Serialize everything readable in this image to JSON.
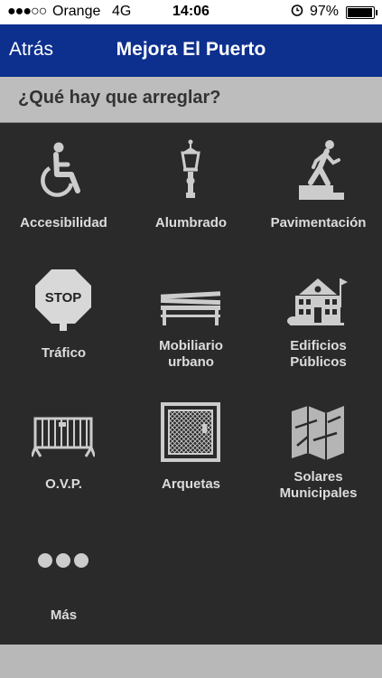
{
  "status_bar": {
    "signal_dots": "●●●○○",
    "carrier": "Orange",
    "network": "4G",
    "time": "14:06",
    "alarm_icon": "alarm-icon",
    "battery_percent": "97%",
    "battery_level": 0.97
  },
  "nav": {
    "back_label": "Atrás",
    "title": "Mejora El Puerto",
    "bar_color": "#0d2f8e"
  },
  "section": {
    "heading": "¿Qué hay que arreglar?"
  },
  "categories": [
    {
      "label": "Accesibilidad",
      "icon": "wheelchair-icon"
    },
    {
      "label": "Alumbrado",
      "icon": "street-lamp-icon"
    },
    {
      "label": "Pavimentación",
      "icon": "pedestrian-step-icon"
    },
    {
      "label": "Tráfico",
      "icon": "stop-sign-icon",
      "sign_text": "STOP"
    },
    {
      "label": "Mobiliario urbano",
      "line1": "Mobiliario",
      "line2": "urbano",
      "icon": "bench-icon"
    },
    {
      "label": "Edificios Públicos",
      "line1": "Edificios",
      "line2": "Públicos",
      "icon": "public-building-icon"
    },
    {
      "label": "O.V.P.",
      "icon": "barrier-fence-icon"
    },
    {
      "label": "Arquetas",
      "icon": "manhole-cover-icon"
    },
    {
      "label": "Solares Municipales",
      "line1": "Solares",
      "line2": "Municipales",
      "icon": "map-plot-icon"
    },
    {
      "label": "Más",
      "icon": "more-dots-icon"
    }
  ]
}
